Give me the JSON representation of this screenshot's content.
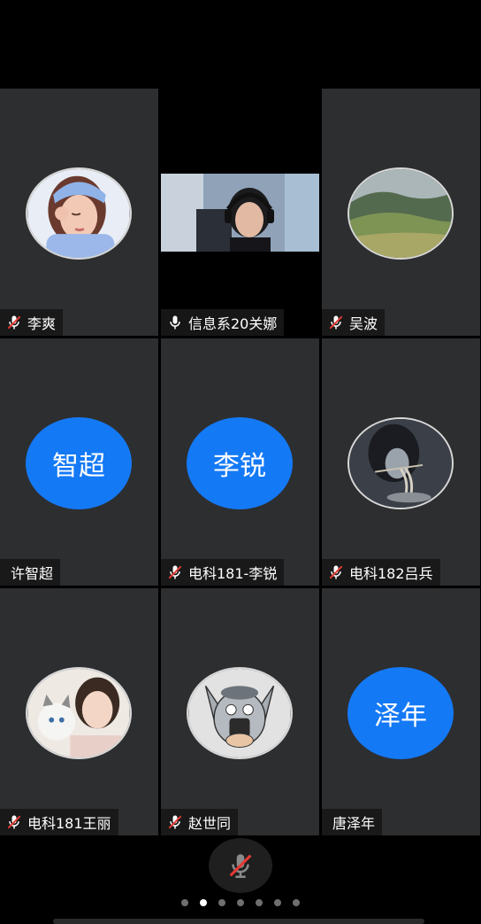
{
  "participants": [
    {
      "name": "李爽",
      "mic": "muted",
      "avatar_kind": "photo",
      "avatar_desc": "cartoon-girl-avatar"
    },
    {
      "name": "信息系20关娜",
      "mic": "on",
      "avatar_kind": "video",
      "avatar_desc": "camera-video-feed"
    },
    {
      "name": "吴波",
      "mic": "muted",
      "avatar_kind": "photo",
      "avatar_desc": "landscape-hill-avatar"
    },
    {
      "name": "许智超",
      "mic": "none",
      "avatar_kind": "text",
      "initials": "智超"
    },
    {
      "name": "电科181-李锐",
      "mic": "muted",
      "avatar_kind": "text",
      "initials": "李锐"
    },
    {
      "name": "电科182吕兵",
      "mic": "muted",
      "avatar_kind": "photo",
      "avatar_desc": "anime-eating-noodles-avatar"
    },
    {
      "name": "电科181王丽",
      "mic": "muted",
      "avatar_kind": "photo",
      "avatar_desc": "girl-with-cat-avatar"
    },
    {
      "name": "赵世同",
      "mic": "muted",
      "avatar_kind": "photo",
      "avatar_desc": "cartoon-cat-avatar"
    },
    {
      "name": "唐泽年",
      "mic": "none",
      "avatar_kind": "text",
      "initials": "泽年"
    }
  ],
  "controls": {
    "mic_state": "muted",
    "mic_icon": "mic-muted-icon"
  },
  "pager": {
    "total": 7,
    "active_index": 1
  },
  "colors": {
    "tile_bg": "#2d2e30",
    "accent_blue": "#1479f5",
    "mute_red": "#e53935"
  }
}
